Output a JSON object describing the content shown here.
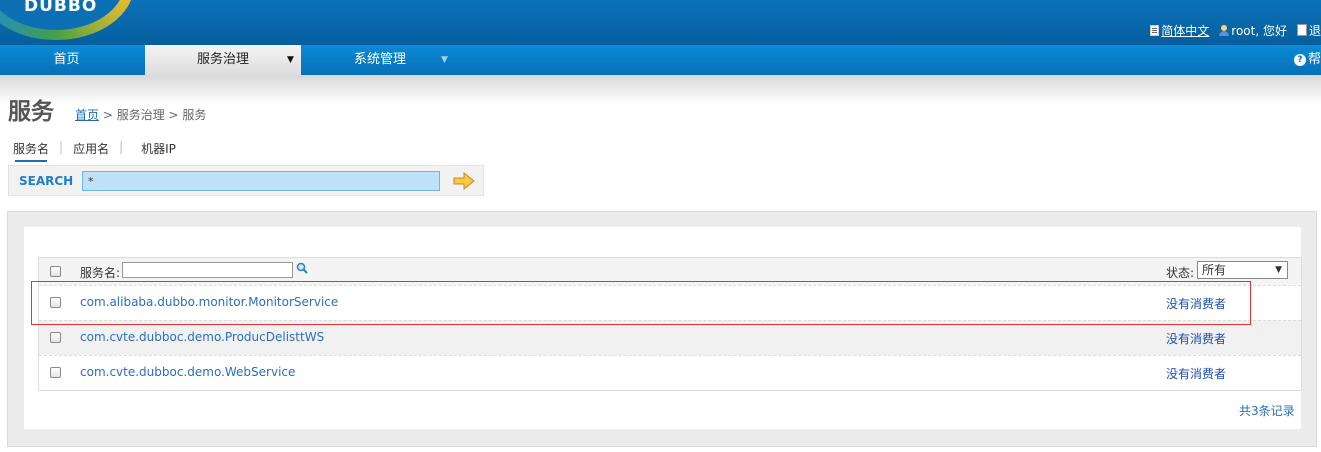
{
  "brand": {
    "logo_text": "DUBBO"
  },
  "top_links": {
    "language": "简体中文",
    "user": "root, 您好",
    "logout": "退"
  },
  "nav": {
    "items": [
      {
        "label": "首页"
      },
      {
        "label": "服务治理",
        "caret": "▼"
      },
      {
        "label": "系统管理",
        "caret": "▼"
      }
    ],
    "help": "帮"
  },
  "page": {
    "title": "服务",
    "breadcrumb": {
      "home": "首页",
      "rest": "> 服务治理 > 服务"
    }
  },
  "search": {
    "tabs": [
      "服务名",
      "应用名",
      "机器IP"
    ],
    "label": "SEARCH",
    "value": "*"
  },
  "table": {
    "header": {
      "name_label": "服务名:",
      "state_label": "状态:",
      "state_value": "所有"
    },
    "rows": [
      {
        "service": "com.alibaba.dubbo.monitor.MonitorService",
        "status": "没有消费者"
      },
      {
        "service": "com.cvte.dubboc.demo.ProducDelisttWS",
        "status": "没有消费者"
      },
      {
        "service": "com.cvte.dubboc.demo.WebService",
        "status": "没有消费者"
      }
    ],
    "total": "共3条记录"
  },
  "colors": {
    "header_blue": "#0b72b8",
    "nav_blue": "#0b8ad6",
    "link_blue": "#2a6fbf",
    "highlight_red": "#e53333",
    "search_input_bg": "#bfe1f7"
  },
  "icons": [
    "document-icon",
    "user-icon",
    "logout-icon",
    "help-icon",
    "arrow-right-icon",
    "magnifier-icon"
  ]
}
